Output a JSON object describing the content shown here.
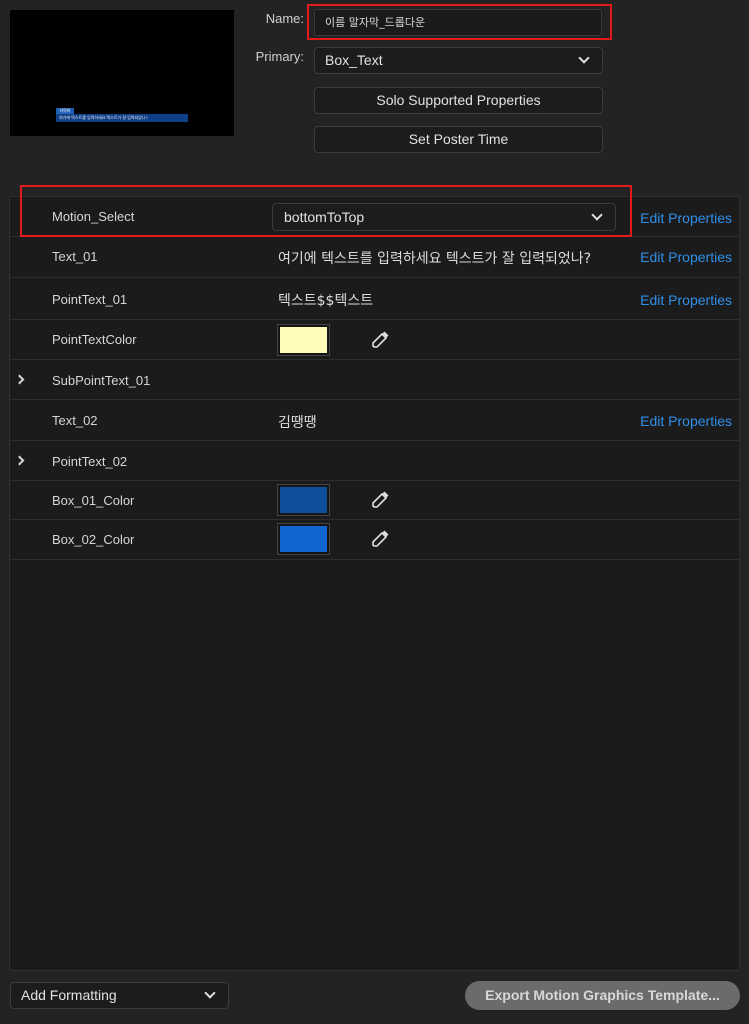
{
  "thumbnail": {
    "tag_text": "자막바",
    "bar_text": "여기에 텍스트를 입력하세요 텍스트가 잘 입력되었나?"
  },
  "header": {
    "name_label": "Name:",
    "name_value": "이름 말자막_드롭다운",
    "primary_label": "Primary:",
    "primary_value": "Box_Text",
    "solo_button": "Solo Supported Properties",
    "poster_button": "Set Poster Time"
  },
  "properties": [
    {
      "name": "Motion_Select",
      "value": "bottomToTop",
      "type": "dropdown",
      "edit": "Edit Properties"
    },
    {
      "name": "Text_01",
      "value": "여기에 텍스트를 입력하세요 텍스트가 잘 입력되었나?",
      "type": "text",
      "edit": "Edit Properties"
    },
    {
      "name": "PointText_01",
      "value": "텍스트$$텍스트",
      "type": "text",
      "edit": "Edit Properties"
    },
    {
      "name": "PointTextColor",
      "type": "color",
      "color": "#FFFBBB"
    },
    {
      "name": "SubPointText_01",
      "type": "group"
    },
    {
      "name": "Text_02",
      "value": "김땡땡",
      "type": "text",
      "edit": "Edit Properties"
    },
    {
      "name": "PointText_02",
      "type": "group"
    },
    {
      "name": "Box_01_Color",
      "type": "color",
      "color": "#0E4E9B"
    },
    {
      "name": "Box_02_Color",
      "type": "color",
      "color": "#0F66D1"
    }
  ],
  "footer": {
    "add_formatting": "Add Formatting",
    "export_button": "Export Motion Graphics Template..."
  },
  "colors": {
    "highlight": "#E11B1B",
    "link": "#2F8FE8"
  }
}
